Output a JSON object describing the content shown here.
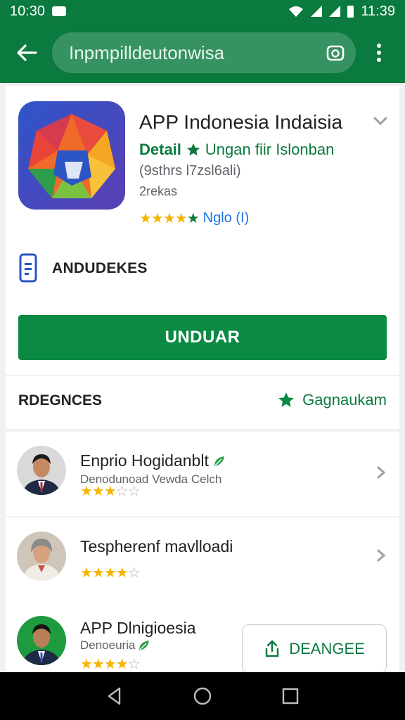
{
  "status_bar": {
    "time_left": "10:30",
    "time_right": "11:39"
  },
  "search": {
    "query": "Inpmpilldeutonwisa"
  },
  "app": {
    "title": "APP Indonesia Indaisia",
    "developer": "Detail",
    "developer_sub": "Ungan fiir Islonban",
    "meta1": "(9sthrs l7zsl6ali)",
    "meta2": "2rekas",
    "rating_stars": 4,
    "rating_text": "Nglo (I)",
    "feature_label": "ANDUDEKES",
    "install_label": "UNDUAR"
  },
  "section": {
    "title": "RDEGNCES",
    "action_label": "Gagnaukam"
  },
  "rows": [
    {
      "title": "Enprio Hogidanblt",
      "subtitle": "Denodunoad Vewda Celch",
      "stars": 2.5
    },
    {
      "title": "Tespherenf mavlloadi",
      "subtitle": "",
      "stars": 4
    },
    {
      "title": "APP Dlnigioesia",
      "subtitle": "Denoeuria",
      "stars": 4,
      "button_label": "DEANGEE"
    }
  ],
  "colors": {
    "primary": "#0b7a3f",
    "button": "#0b8a43",
    "star": "#f4b400",
    "link": "#1a73e8"
  }
}
